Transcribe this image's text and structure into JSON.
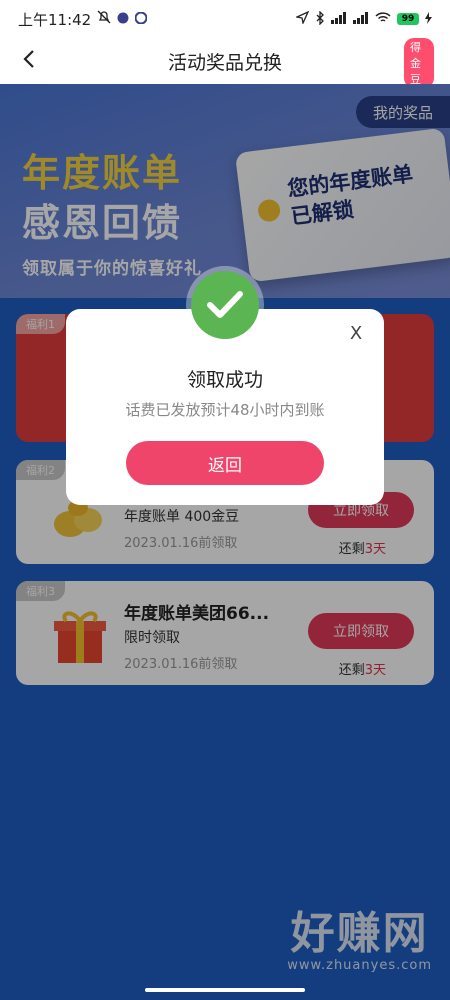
{
  "status_bar": {
    "time": "上午11:42",
    "battery": "99"
  },
  "header": {
    "title": "活动奖品兑换",
    "coin_badge": "得金豆"
  },
  "banner": {
    "title_line1": "年度账单",
    "title_line2": "感恩回馈",
    "subtitle": "领取属于你的惊喜好礼",
    "my_prize": "我的奖品",
    "card_text": "您的年度账单已解锁"
  },
  "cards": [
    {
      "tag": "福利1",
      "title": "",
      "subtitle": "",
      "date": ""
    },
    {
      "tag": "福利2",
      "title": "",
      "subtitle": "年度账单 400金豆",
      "date": "2023.01.16前领取",
      "button": "立即领取",
      "remain_prefix": "还剩",
      "remain_value": "3天"
    },
    {
      "tag": "福利3",
      "title": "年度账单美团66...",
      "subtitle": "限时领取",
      "date": "2023.01.16前领取",
      "button": "立即领取",
      "remain_prefix": "还剩",
      "remain_value": "3天"
    }
  ],
  "dialog": {
    "close": "X",
    "title": "领取成功",
    "message": "话费已发放预计48小时内到账",
    "button": "返回"
  },
  "watermark": {
    "big": "好赚网",
    "small": "www.zhuanyes.com"
  },
  "colors": {
    "primary_red": "#e03a5a",
    "success_green": "#5ab552",
    "page_blue": "#1f5ec4"
  }
}
